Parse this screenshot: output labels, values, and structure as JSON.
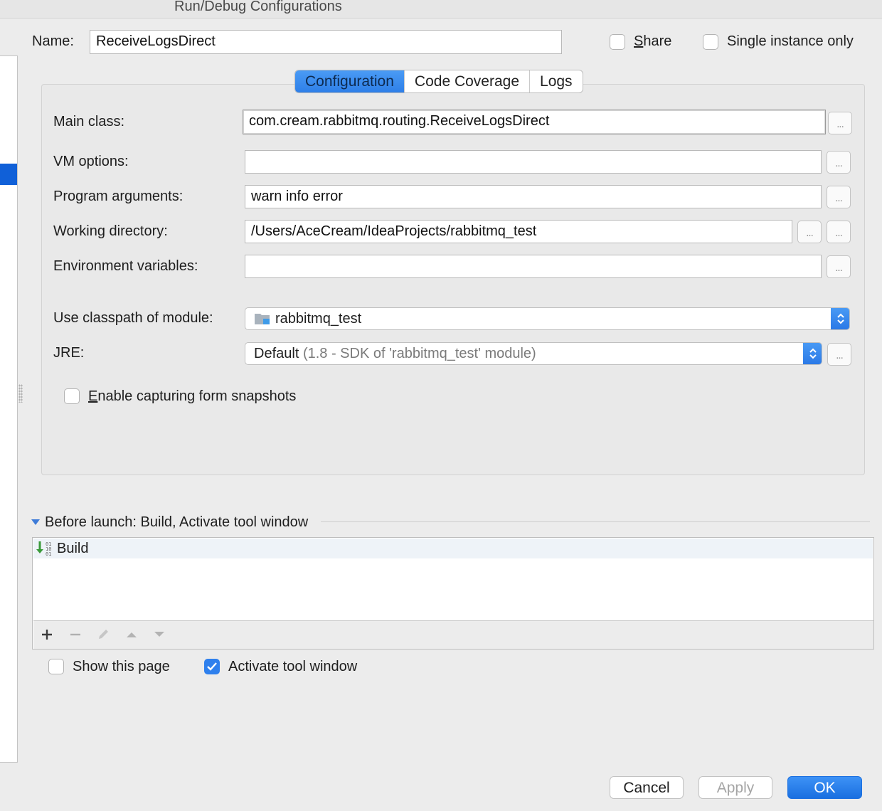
{
  "window": {
    "title": "Run/Debug Configurations"
  },
  "header": {
    "name_label": "Name:",
    "name_value": "ReceiveLogsDirect",
    "share_label": "Share",
    "share_checked": false,
    "single_instance_label": "Single instance only",
    "single_instance_checked": false
  },
  "tabs": [
    {
      "label": "Configuration",
      "active": true
    },
    {
      "label": "Code Coverage",
      "active": false
    },
    {
      "label": "Logs",
      "active": false
    }
  ],
  "form": {
    "main_class_label": "Main class:",
    "main_class_value": "com.cream.rabbitmq.routing.ReceiveLogsDirect",
    "vm_options_label": "VM options:",
    "vm_options_value": "",
    "program_args_label": "Program arguments:",
    "program_args_value": "warn info error",
    "working_dir_label": "Working directory:",
    "working_dir_value": "/Users/AceCream/IdeaProjects/rabbitmq_test",
    "env_vars_label": "Environment variables:",
    "env_vars_value": "",
    "classpath_label": "Use classpath of module:",
    "classpath_value": "rabbitmq_test",
    "jre_label": "JRE:",
    "jre_value": "Default",
    "jre_detail": "(1.8 - SDK of 'rabbitmq_test' module)",
    "browse_label": "...",
    "snapshots_label": "Enable capturing form snapshots",
    "snapshots_checked": false
  },
  "before_launch": {
    "title": "Before launch: Build, Activate tool window",
    "tasks": [
      {
        "label": "Build",
        "icon": "build-icon"
      }
    ],
    "toolbar": [
      "add-icon",
      "remove-icon",
      "edit-icon",
      "move-up-icon",
      "move-down-icon"
    ]
  },
  "options": {
    "show_page_label": "Show this page",
    "show_page_checked": false,
    "activate_tool_label": "Activate tool window",
    "activate_tool_checked": true
  },
  "footer": {
    "cancel_label": "Cancel",
    "apply_label": "Apply",
    "ok_label": "OK"
  },
  "colors": {
    "accent": "#2e7fe8",
    "selection": "#1060d8"
  }
}
